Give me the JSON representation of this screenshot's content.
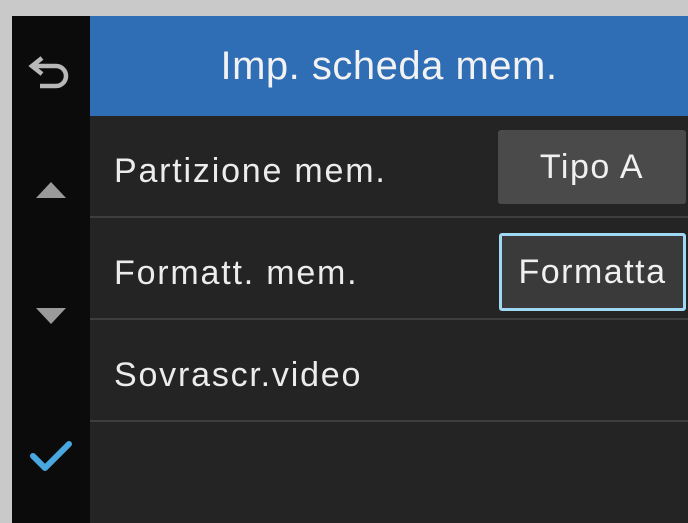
{
  "header": {
    "title": "Imp. scheda mem."
  },
  "sidebar": {
    "buttons": [
      {
        "name": "back",
        "icon": "back-arrow-icon"
      },
      {
        "name": "up",
        "icon": "triangle-up-icon"
      },
      {
        "name": "down",
        "icon": "triangle-down-icon"
      },
      {
        "name": "confirm",
        "icon": "checkmark-icon"
      }
    ]
  },
  "menu": {
    "items": [
      {
        "label": "Partizione mem.",
        "value": "Tipo A"
      },
      {
        "label": "Formatt. mem.",
        "value": "Formatta"
      },
      {
        "label": "Sovrascr.video",
        "value": ""
      }
    ]
  },
  "colors": {
    "title_bar": "#2f6db5",
    "background": "#242424",
    "sidebar": "#0b0b0b",
    "focus_border": "#9fd8f2",
    "check": "#4aa8e0"
  }
}
